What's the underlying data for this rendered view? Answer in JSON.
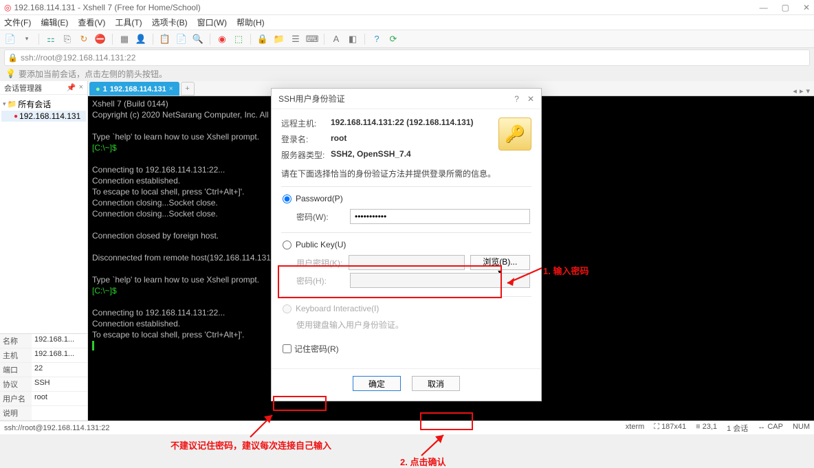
{
  "titlebar": {
    "text": "192.168.114.131 - Xshell 7 (Free for Home/School)"
  },
  "menu": {
    "file": "文件(F)",
    "edit": "编辑(E)",
    "view": "查看(V)",
    "tools": "工具(T)",
    "tab": "选项卡(B)",
    "window": "窗口(W)",
    "help": "帮助(H)"
  },
  "address": "ssh://root@192.168.114.131:22",
  "hint": "要添加当前会话，点击左侧的箭头按钮。",
  "sidebar": {
    "title": "会话管理器",
    "root": "所有会话",
    "item": "192.168.114.131"
  },
  "props": {
    "name_lbl": "名称",
    "name_val": "192.168.1...",
    "host_lbl": "主机",
    "host_val": "192.168.1...",
    "port_lbl": "端口",
    "port_val": "22",
    "proto_lbl": "协议",
    "proto_val": "SSH",
    "user_lbl": "用户名",
    "user_val": "root",
    "desc_lbl": "说明",
    "desc_val": ""
  },
  "tab": {
    "num": "1",
    "label": "192.168.114.131",
    "add": "+"
  },
  "term": {
    "l1": "Xshell 7 (Build 0144)",
    "l2": "Copyright (c) 2020 NetSarang Computer, Inc. All rights reserved.",
    "blank": "",
    "l3": "Type `help' to learn how to use Xshell prompt.",
    "prompt": "[C:\\~]$",
    "l5": "Connecting to 192.168.114.131:22...",
    "l6": "Connection established.",
    "l7": "To escape to local shell, press 'Ctrl+Alt+]'.",
    "l8": "Connection closing...Socket close.",
    "l9": "Connection closing...Socket close.",
    "l10": "Connection closed by foreign host.",
    "l11": "Disconnected from remote host(192.168.114.131) at 18:35:14.",
    "l12": "Type `help' to learn how to use Xshell prompt.",
    "l14": "Connecting to 192.168.114.131:22...",
    "l15": "Connection established.",
    "l16": "To escape to local shell, press 'Ctrl+Alt+]'."
  },
  "dialog": {
    "title": "SSH用户身份验证",
    "remote_lbl": "远程主机:",
    "remote_val": "192.168.114.131:22 (192.168.114.131)",
    "login_lbl": "登录名:",
    "login_val": "root",
    "type_lbl": "服务器类型:",
    "type_val": "SSH2, OpenSSH_7.4",
    "instr": "请在下面选择恰当的身份验证方法并提供登录所需的信息。",
    "pwd_radio": "Password(P)",
    "pwd_lbl": "密码(W):",
    "pwd_val": "•••••••••••",
    "pk_radio": "Public Key(U)",
    "pk_key_lbl": "用户密钥(K):",
    "pk_browse": "浏览(B)... ▾",
    "pk_pwd_lbl": "密码(H):",
    "ki_radio": "Keyboard Interactive(I)",
    "ki_hint": "使用键盘输入用户身份验证。",
    "remember": "记住密码(R)",
    "ok": "确定",
    "cancel": "取消"
  },
  "anno": {
    "a1": "1. 输入密码",
    "a2": "2. 点击确认",
    "a3": "不建议记住密码，建议每次连接自己输入"
  },
  "status": {
    "left": "ssh://root@192.168.114.131:22",
    "mode": "xterm",
    "size": "187x41",
    "pos": "23,1",
    "sess": "1 会话",
    "cap": "CAP",
    "num": "NUM"
  }
}
